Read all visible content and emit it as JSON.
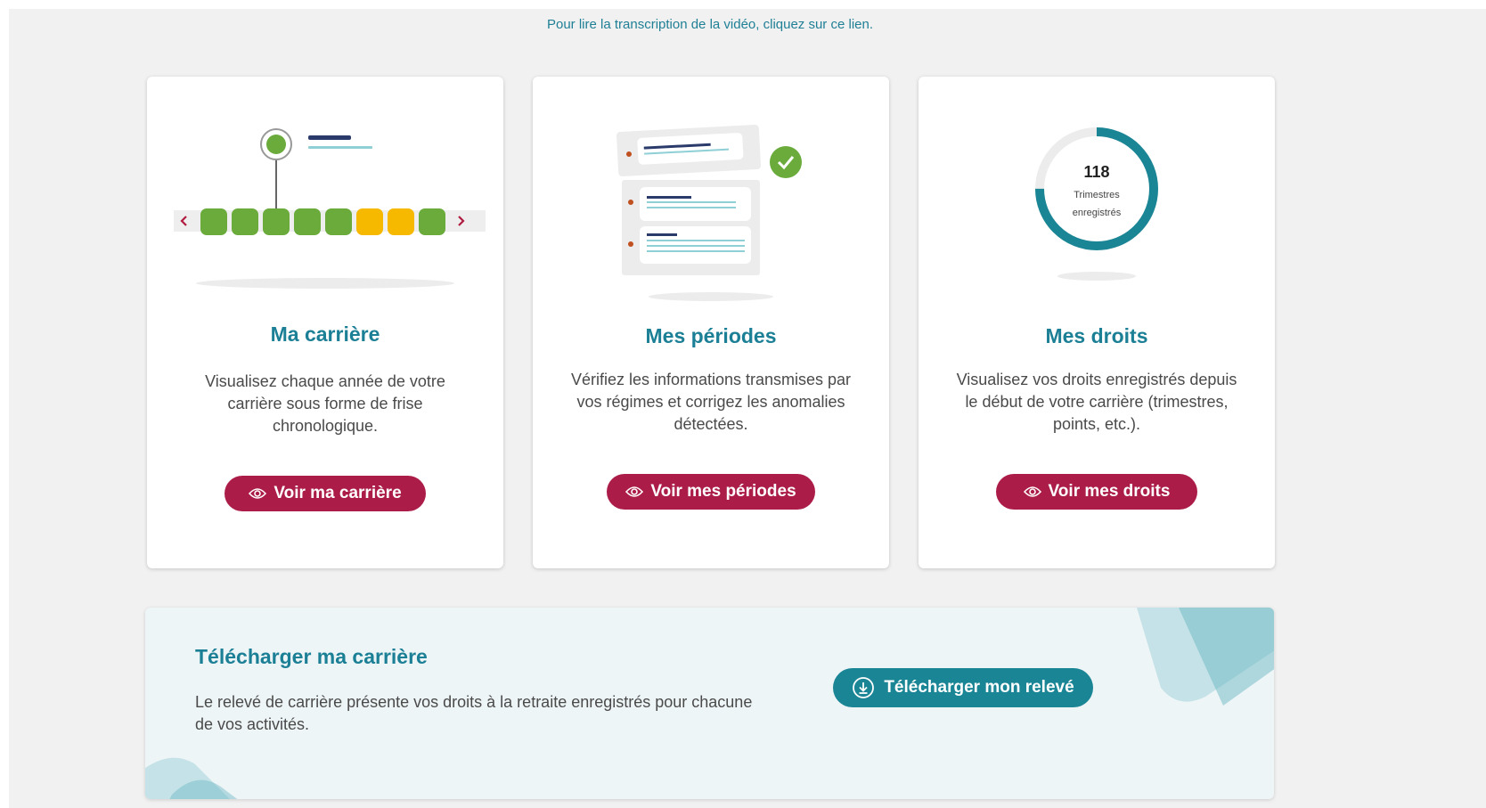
{
  "transcript_link": "Pour lire la transcription de la vidéo, cliquez sur ce lien.",
  "cards": [
    {
      "title": "Ma carrière",
      "description": "Visualisez chaque année de votre carrière sous forme de frise chronologique.",
      "button": "Voir ma carrière"
    },
    {
      "title": "Mes périodes",
      "description": "Vérifiez les informations transmises par vos régimes et corrigez les anomalies détectées.",
      "button": "Voir mes périodes"
    },
    {
      "title": "Mes droits",
      "description": "Visualisez vos droits enregistrés depuis le début de votre carrière (trimestres, points, etc.).",
      "button": "Voir mes droits",
      "gauge_value": "118",
      "gauge_label_line1": "Trimestres",
      "gauge_label_line2": "enregistrés"
    }
  ],
  "download": {
    "title": "Télécharger ma carrière",
    "description": "Le relevé de carrière présente vos droits à la retraite enregistrés pour chacune de vos activités.",
    "button": "Télécharger mon relevé"
  },
  "colors": {
    "title_teal": "#1b7f95",
    "button_red": "#ab1d48",
    "button_teal": "#1a8595",
    "green_block": "#6aab3c",
    "orange_block": "#f7b800"
  },
  "icons": [
    "eye-icon",
    "download-icon",
    "check-icon",
    "chevron-left-icon",
    "chevron-right-icon"
  ]
}
